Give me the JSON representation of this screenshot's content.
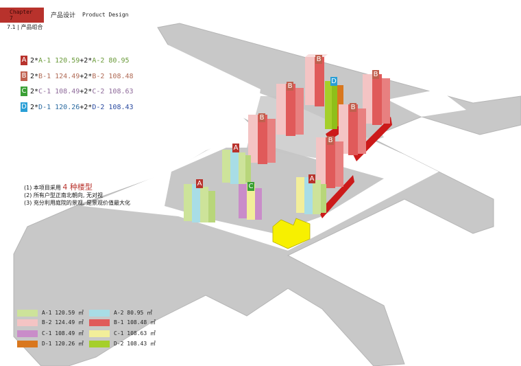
{
  "header": {
    "chapter": "Chapter 7",
    "title_cn": "产品设计",
    "title_en": "Product Design"
  },
  "section": "7.1 | 产品组合",
  "combos": [
    {
      "letter": "A",
      "color": "#b8322c",
      "p1": "2*",
      "n1": "A-1 120.59",
      "p2": "+2*",
      "n2": "A-2 80.95",
      "c1": "#6a9a3a",
      "c2": "#6a9a3a"
    },
    {
      "letter": "B",
      "color": "#c0604e",
      "p1": "2*",
      "n1": "B-1 124.49",
      "p2": "+2*",
      "n2": "B-2 108.48",
      "c1": "#b06a55",
      "c2": "#b06a55"
    },
    {
      "letter": "C",
      "color": "#3aa035",
      "p1": "2*",
      "n1": "C-1 108.49",
      "p2": "+2*",
      "n2": "C-2 108.63",
      "c1": "#8e6a9a",
      "c2": "#8e6a9a"
    },
    {
      "letter": "D",
      "color": "#2a9fd6",
      "p1": "2*",
      "n1": "D-1 120.26",
      "p2": "+2*",
      "n2": "D-2 108.43",
      "c1": "#2a6aa0",
      "c2": "#2a4aa0"
    }
  ],
  "notes": {
    "n1_pre": "(1) 本项目采用",
    "n1_big": "4 种楼型",
    "n2": "(2) 所有户型正南北朝向, 无对视",
    "n3": "(3) 充分利用庭院的景观, 是景观价值最大化"
  },
  "legend": [
    {
      "label": "A-1 120.59 ㎡",
      "color": "#cde39a"
    },
    {
      "label": "A-2 80.95 ㎡",
      "color": "#a8dde6"
    },
    {
      "label": "B-2 124.49 ㎡",
      "color": "#f4c4c4"
    },
    {
      "label": "B-1 108.48 ㎡",
      "color": "#e05a5a"
    },
    {
      "label": "C-1 108.49 ㎡",
      "color": "#c98cc9"
    },
    {
      "label": "C-1 108.63 ㎡",
      "color": "#f2ee9a"
    },
    {
      "label": "D-1 120.26 ㎡",
      "color": "#d9771e"
    },
    {
      "label": "D-2 108.43 ㎡",
      "color": "#a5cf2a"
    }
  ],
  "map_labels": {
    "a": "A",
    "b": "B",
    "c": "C",
    "d": "D"
  }
}
